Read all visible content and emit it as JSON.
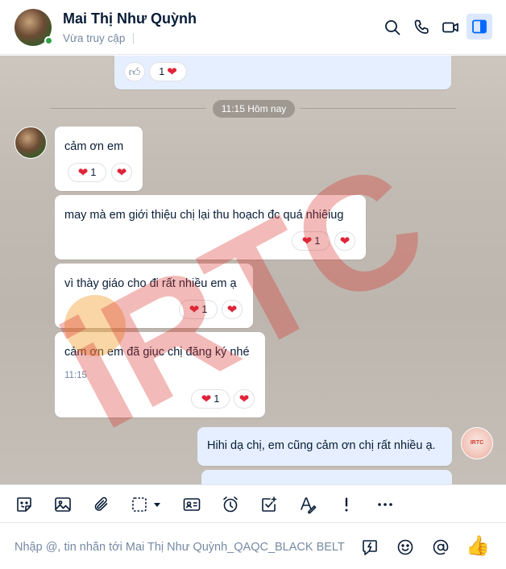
{
  "header": {
    "contact_name": "Mai Thị Như Quỳnh",
    "status": "Vừa truy cập",
    "icons": [
      "search-icon",
      "phone-icon",
      "video-icon",
      "side-panel-icon"
    ]
  },
  "chat": {
    "previous_message": {
      "reaction_like": "like-icon",
      "reaction_count": "1",
      "reaction_icon": "heart-icon"
    },
    "date_divider": "11:15 Hôm nay",
    "messages": [
      {
        "text": "cảm ơn em",
        "reaction_count": "1",
        "time": ""
      },
      {
        "text": "may mà em giới thiệu chị lại thu hoạch đc quá nhiêiug",
        "reaction_count": "1",
        "time": ""
      },
      {
        "text": "vì thày giáo cho đi rất nhiều em ạ",
        "reaction_count": "1",
        "time": ""
      },
      {
        "text": "cảm ơn em đã giục chị đăng ký nhé",
        "reaction_count": "1",
        "time": "11:15"
      }
    ],
    "my_message": {
      "text": "Hihi dạ chị, em cũng cảm ơn chị rất nhiều ạ."
    },
    "my_avatar_text": "IRTC",
    "watermark": "iRTC",
    "colors": {
      "accent": "#0068ff",
      "heart": "#e0243a",
      "watermark": "#d8322b"
    }
  },
  "toolbar": {
    "items": [
      "sticker-icon",
      "image-icon",
      "attachment-icon",
      "screenshot-icon",
      "contact-card-icon",
      "reminder-icon",
      "task-icon",
      "text-format-icon",
      "urgent-icon",
      "more-icon"
    ]
  },
  "composer": {
    "placeholder": "Nhập @, tin nhắn tới Mai Thị Như Quỳnh_QAQC_BLACK BELT",
    "value": "",
    "icons": [
      "quick-message-icon",
      "emoji-icon",
      "mention-icon",
      "thumbs-up-icon"
    ]
  }
}
